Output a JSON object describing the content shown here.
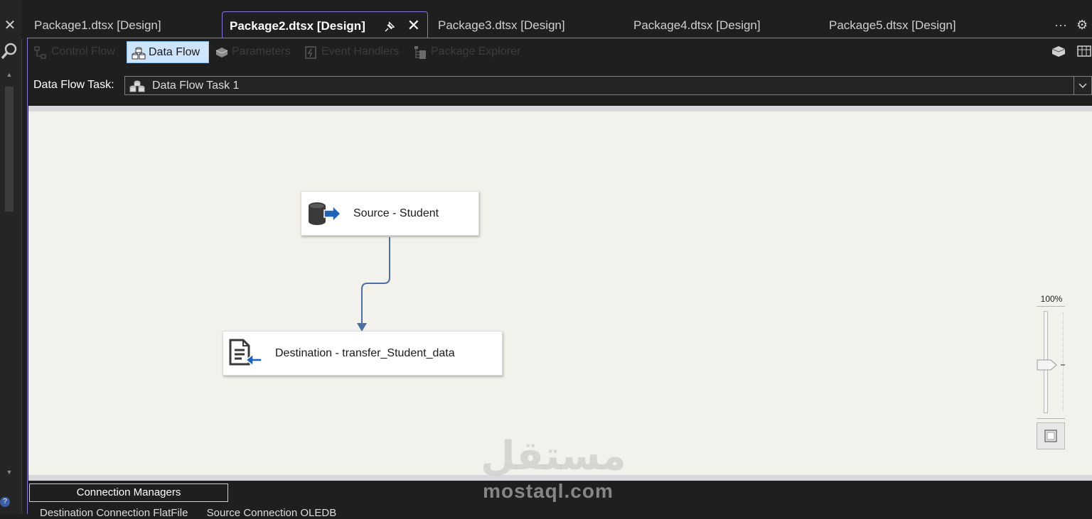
{
  "tabs": [
    {
      "label": "Package1.dtsx [Design]",
      "active": false
    },
    {
      "label": "Package2.dtsx [Design]",
      "active": true
    },
    {
      "label": "Package3.dtsx [Design]",
      "active": false
    },
    {
      "label": "Package4.dtsx [Design]",
      "active": false
    },
    {
      "label": "Package5.dtsx [Design]",
      "active": false
    }
  ],
  "tab_overflow": "···",
  "designer_toolbar": [
    {
      "label": "Control Flow",
      "icon": "control-flow-icon",
      "active": false
    },
    {
      "label": "Data Flow",
      "icon": "data-flow-icon",
      "active": true
    },
    {
      "label": "Parameters",
      "icon": "parameters-icon",
      "active": false
    },
    {
      "label": "Event Handlers",
      "icon": "event-handlers-icon",
      "active": false
    },
    {
      "label": "Package Explorer",
      "icon": "package-explorer-icon",
      "active": false
    }
  ],
  "data_flow_task": {
    "label": "Data Flow Task:",
    "selected": "Data Flow Task 1"
  },
  "canvas": {
    "components": [
      {
        "label": "Source - Student",
        "icon": "ole-db-source-icon"
      },
      {
        "label": "Destination - transfer_Student_data",
        "icon": "flat-file-destination-icon"
      }
    ]
  },
  "zoom": {
    "label": "100%",
    "level_percent": 100
  },
  "connection_managers": {
    "title": "Connection Managers",
    "items": [
      "Destination Connection FlatFile",
      "Source Connection OLEDB"
    ]
  },
  "watermark": {
    "arabic": "مستقل",
    "latin": "mostaql.com"
  },
  "colors": {
    "accent": "#8a73d8",
    "canvas_bg": "#f3f1eb",
    "path_line": "#4d6fa3",
    "selected_tool_bg": "#cde4fb"
  }
}
